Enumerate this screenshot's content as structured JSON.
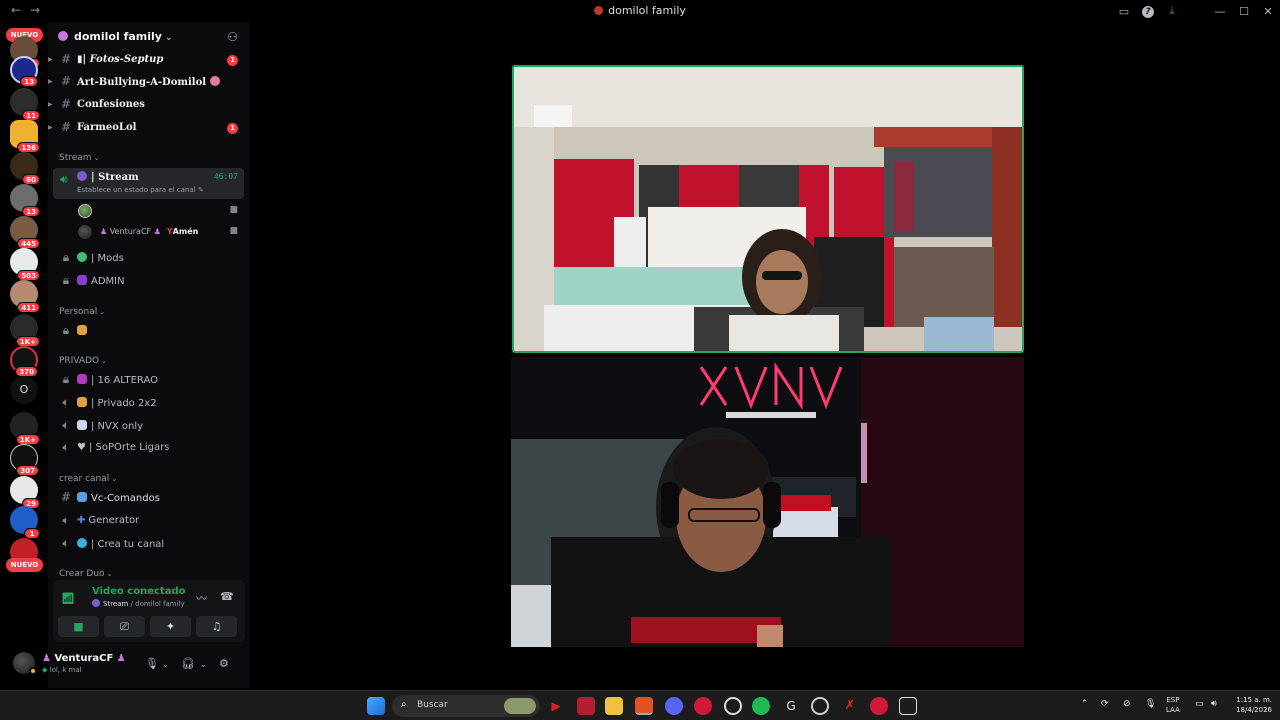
{
  "window": {
    "title": "domilol family",
    "back_icon": "←",
    "forward_icon": "→"
  },
  "rail": {
    "nuevo_top": "NUEVO",
    "nuevo_bottom": "NUEVO",
    "badges": [
      "1",
      "13",
      "11",
      "136",
      "60",
      "13",
      "445",
      "503",
      "411",
      "1K+",
      "370",
      "1K+",
      "307",
      "29",
      "1"
    ],
    "letter_server": "O"
  },
  "server": {
    "name": "domilol family",
    "chevron": "⌄"
  },
  "channels_top": [
    {
      "prefix": "▮|",
      "name": "Fotos-Septup",
      "unread": "1"
    },
    {
      "prefix": "",
      "name": "Art-Bullying-A-Domilol",
      "unread": ""
    },
    {
      "prefix": "",
      "name": "Confesiones",
      "unread": ""
    },
    {
      "prefix": "",
      "name": "FarmeoLol",
      "unread": "1"
    }
  ],
  "categories": {
    "stream": "Stream",
    "personal": "Personal",
    "privado": "PRIVADO",
    "crear_canal": "crear canal",
    "crear_duo": "Crear Duo"
  },
  "stream_channel": {
    "name": "| Stream",
    "timer": "46:07",
    "status": "Establece un estado para el canal"
  },
  "voice_users": [
    {
      "name": "",
      "extra": ""
    },
    {
      "name": "VenturaCF",
      "extra": "Amén"
    }
  ],
  "stream_section": [
    {
      "name": "| Mods"
    },
    {
      "name": "ADMIN"
    }
  ],
  "privado_channels": [
    {
      "name": "| 16 ALTERAO"
    },
    {
      "name": "| Privado 2x2"
    },
    {
      "name": "| NVX only"
    },
    {
      "name": "| SoPOrte Ligars"
    }
  ],
  "crear_canal_channels": [
    {
      "name": "Vc-Comandos"
    },
    {
      "name": "Generator"
    },
    {
      "name": "| Crea tu canal"
    }
  ],
  "voice_panel": {
    "label": "Video conectado",
    "channel": "Stream",
    "server": "domilol family"
  },
  "user": {
    "name": "VenturaCF",
    "status": "lol, k mal"
  },
  "taskbar": {
    "search_placeholder": "Buscar",
    "lang_line1": "ESP",
    "lang_line2": "LAA",
    "time": "1:15 a. m.",
    "date": "18/4/2026"
  },
  "colors": {
    "accent_green": "#23a55a",
    "badge_red": "#f23f43",
    "sidebar_bg": "#0b0b0d"
  }
}
